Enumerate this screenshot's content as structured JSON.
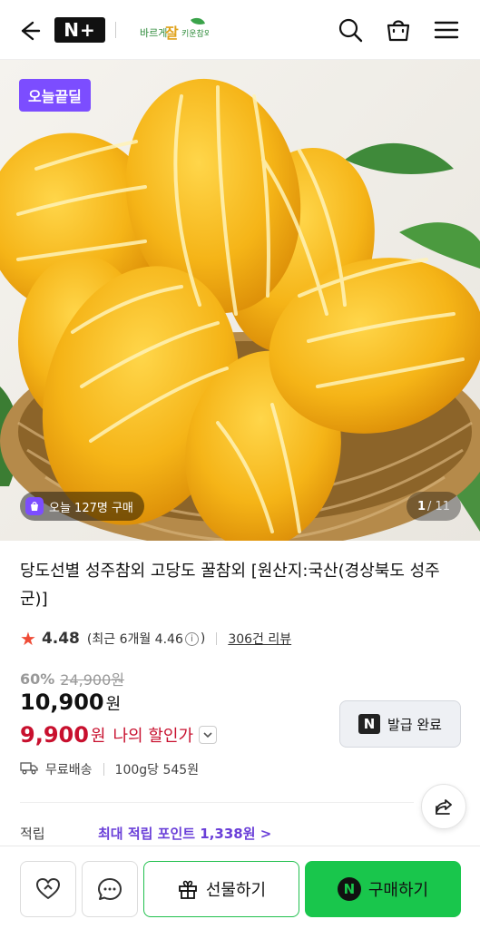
{
  "header": {
    "brand_badge": "N+",
    "store_logo_text": "바르게 잘 키운 참외",
    "icons": [
      "back-arrow-icon",
      "search-icon",
      "shopping-bag-icon",
      "hamburger-menu-icon"
    ]
  },
  "hero": {
    "deal_badge": "오늘끝딜",
    "buyers_today": "오늘 127명 구매",
    "page_current": "1",
    "page_total": "/ 11"
  },
  "product": {
    "title": "당도선별 성주참외 고당도 꿀참외 [원산지:국산(경상북도 성주군)]",
    "rating": "4.48",
    "recent_rating": "(최근 6개월 4.46",
    "recent_rating_close": ")",
    "review_count": "306건 리뷰",
    "discount_rate": "60%",
    "original_price": "24,900원",
    "price": "10,900",
    "price_unit": "원",
    "my_price": "9,900",
    "my_price_unit": "원",
    "my_price_label": "나의 할인가",
    "coupon_button": "발급 완료",
    "shipping": "무료배송",
    "unit_price": "100g당 545원",
    "points_label": "적립",
    "points_value": "최대 적립 포인트 1,338원 >"
  },
  "bottom_bar": {
    "gift_label": "선물하기",
    "buy_label": "구매하기"
  },
  "colors": {
    "accent_purple": "#7c4dff",
    "price_red": "#c8102e",
    "naver_green": "#19c64c",
    "points_purple": "#6a3fd8",
    "star": "#ef4b36"
  }
}
